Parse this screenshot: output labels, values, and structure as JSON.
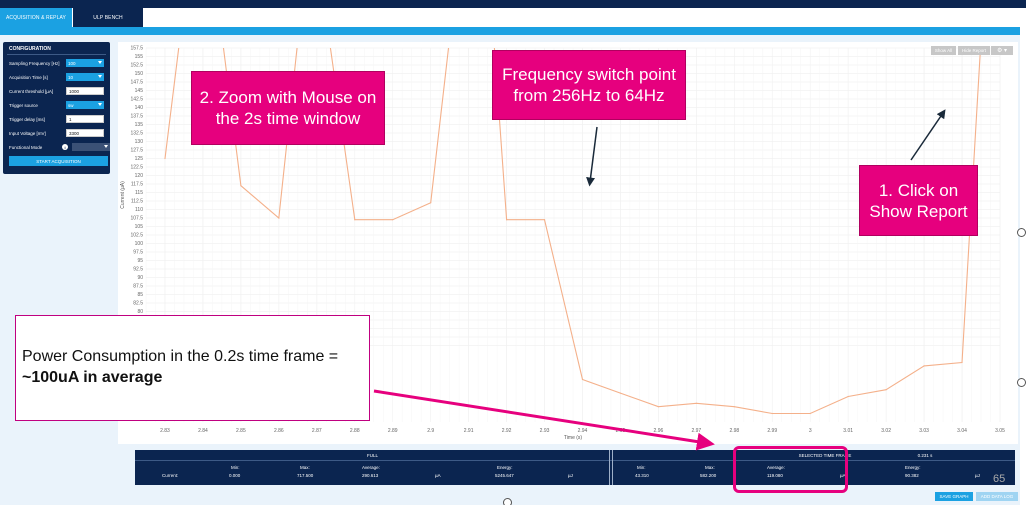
{
  "tabs": [
    {
      "label": "ACQUISITION & REPLAY",
      "active": true
    },
    {
      "label": "ULP BENCH",
      "active": false
    }
  ],
  "config": {
    "title": "CONFIGURATION",
    "rows": [
      {
        "label": "Sampling Frequency [Hz]",
        "value": "100",
        "kind": "select"
      },
      {
        "label": "Acquisition Time [s]",
        "value": "10",
        "kind": "select"
      },
      {
        "label": "Current threshold [µA]",
        "value": "1000",
        "kind": "input"
      },
      {
        "label": "Trigger source",
        "value": "sw",
        "kind": "select"
      },
      {
        "label": "Trigger delay [ms]",
        "value": "1",
        "kind": "input"
      },
      {
        "label": "Input Voltage [mV]",
        "value": "3300",
        "kind": "input"
      },
      {
        "label": "Functional Mode",
        "value": "",
        "kind": "disabled"
      }
    ],
    "info_icon": "info-icon",
    "start_label": "START ACQUISITION"
  },
  "chart_controls": {
    "show_all": "Show All",
    "hide_report": "Hide Report",
    "gear_icon": "gear-icon",
    "gear_glyph": "⚙ ▾"
  },
  "chart_data": {
    "type": "line",
    "xlabel": "Time (s)",
    "ylabel": "Current (µA)",
    "ylim": [
      70,
      157.5
    ],
    "xlim": [
      2.825,
      3.05
    ],
    "x_ticks": [
      "2.83",
      "2.84",
      "2.85",
      "2.86",
      "2.87",
      "2.88",
      "2.89",
      "2.9",
      "2.91",
      "2.92",
      "2.93",
      "2.94",
      "2.95",
      "2.96",
      "2.97",
      "2.98",
      "2.99",
      "3",
      "3.01",
      "3.02",
      "3.03",
      "3.04",
      "3.05"
    ],
    "y_ticks": [
      "157.5",
      "155",
      "152.5",
      "150",
      "147.5",
      "145",
      "142.5",
      "140",
      "137.5",
      "135",
      "132.5",
      "130",
      "127.5",
      "125",
      "122.5",
      "120",
      "117.5",
      "115",
      "112.5",
      "110",
      "107.5",
      "105",
      "102.5",
      "100",
      "97.5",
      "95",
      "92.5",
      "90",
      "87.5",
      "85",
      "82.5",
      "80",
      "77.5",
      "75",
      "72.5",
      "70"
    ],
    "grid": true,
    "series": [
      {
        "color": "#f4b08a",
        "x": [
          2.83,
          2.835,
          2.844,
          2.85,
          2.86,
          2.866,
          2.872,
          2.88,
          2.89,
          2.9,
          2.906,
          2.916,
          2.92,
          2.93,
          2.94,
          2.95,
          2.96,
          2.97,
          2.98,
          2.99,
          3.0,
          3.01,
          3.02,
          3.03,
          3.04,
          3.045
        ],
        "y": [
          125,
          170,
          170,
          117,
          107.5,
          170,
          170,
          107,
          107,
          112,
          170,
          170,
          107,
          107,
          60,
          56,
          52,
          53,
          52,
          50,
          50,
          55,
          57,
          64,
          65,
          160
        ]
      }
    ]
  },
  "stats": {
    "full_header": "FULL",
    "selected_header": "SELECTED TIME FRAME",
    "selected_duration": "0.231 s",
    "row_label": "Current:",
    "full": {
      "min_label": "Min:",
      "min": "0.000",
      "max_label": "Max:",
      "max": "717.500",
      "avg_label": "Average:",
      "avg": "290.613",
      "unit_ua": "µA",
      "energy_label": "Energy:",
      "energy": "5245.647",
      "unit_uj": "µJ"
    },
    "selected": {
      "min_label": "Min:",
      "min": "43.310",
      "max_label": "Max:",
      "max": "582.200",
      "avg_label": "Average:",
      "avg": "119.080",
      "unit_ua": "µA",
      "energy_label": "Energy:",
      "energy": "90.382",
      "unit_uj": "µJ"
    }
  },
  "buttons": {
    "save_graph": "SAVE GRAPH",
    "add_data_log": "ADD DATA LOG"
  },
  "annotations": {
    "zoom": "2. Zoom with Mouse on the 2s time window",
    "freq": "Frequency switch point from 256Hz to 64Hz",
    "click": "1. Click on Show Report",
    "note_plain": "Power Consumption in the 0.2s time frame = ",
    "note_bold": "~100uA in average"
  },
  "page_number": "65",
  "colors": {
    "navy": "#0b2550",
    "accent": "#1ba1e2",
    "magenta": "#e6007e",
    "trace": "#f4b08a"
  }
}
